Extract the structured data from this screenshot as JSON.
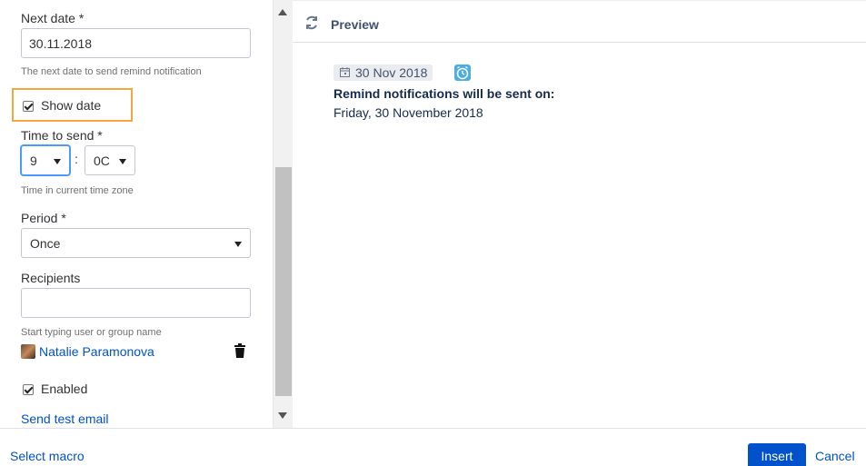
{
  "form": {
    "next_date_label": "Next date *",
    "next_date_value": "30.11.2018",
    "next_date_hint": "The next date to send remind notification",
    "show_date_label": "Show date",
    "show_date_checked": true,
    "time_label": "Time to send *",
    "hour_value": "9",
    "minute_value": "0C",
    "time_separator": ":",
    "time_hint": "Time in current time zone",
    "period_label": "Period *",
    "period_value": "Once",
    "recipients_label": "Recipients",
    "recipients_value": "",
    "recipients_hint": "Start typing user or group name",
    "recipients_list": [
      {
        "name": "Natalie Paramonova"
      }
    ],
    "enabled_label": "Enabled",
    "enabled_checked": true,
    "send_test_label": "Send test email"
  },
  "preview": {
    "title": "Preview",
    "date_chip": "30 Nov 2018",
    "reminder_heading": "Remind notifications will be sent on:",
    "reminder_date": "Friday, 30 November 2018"
  },
  "footer": {
    "select_macro_label": "Select macro",
    "insert_label": "Insert",
    "cancel_label": "Cancel"
  },
  "colors": {
    "accent": "#0052cc",
    "highlight": "#f6a540",
    "clock_badge": "#4bade8"
  },
  "icons": {
    "preview_icon": "refresh-icon",
    "date_icon": "calendar-icon",
    "clock_icon": "clock-icon",
    "remove_icon": "trash-icon"
  }
}
